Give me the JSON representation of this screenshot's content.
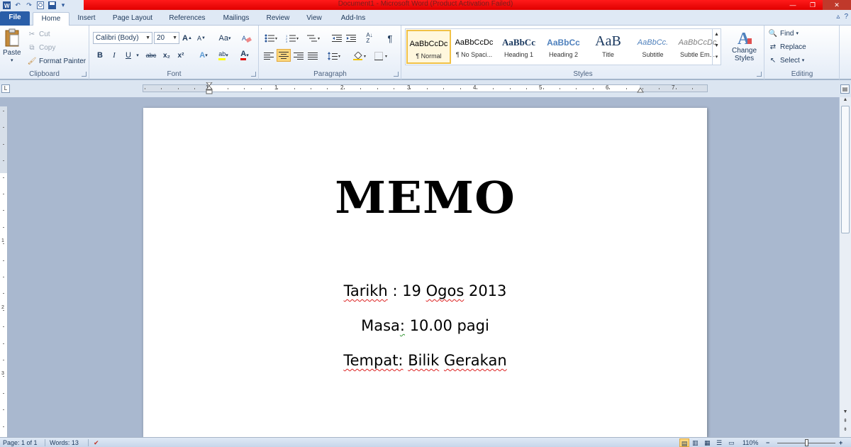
{
  "window": {
    "title": "Document1  -  Microsoft Word (Product Activation Failed)"
  },
  "qat": {
    "icons": [
      "word-logo-icon",
      "undo-icon",
      "redo-icon",
      "print-preview-icon",
      "save-icon",
      "customize-icon"
    ]
  },
  "tabs": {
    "file": "File",
    "home": "Home",
    "insert": "Insert",
    "page_layout": "Page Layout",
    "references": "References",
    "mailings": "Mailings",
    "review": "Review",
    "view": "View",
    "addins": "Add-Ins"
  },
  "clipboard": {
    "paste": "Paste",
    "cut": "Cut",
    "copy": "Copy",
    "format_painter": "Format Painter",
    "label": "Clipboard"
  },
  "font": {
    "family": "Calibri (Body)",
    "size": "20",
    "grow": "A",
    "shrink": "A",
    "change_case": "Aa",
    "bold": "B",
    "italic": "I",
    "underline": "U",
    "strike": "abc",
    "subscript": "x₂",
    "superscript": "x²",
    "label": "Font"
  },
  "paragraph": {
    "label": "Paragraph",
    "pilcrow": "¶"
  },
  "styles": {
    "label": "Styles",
    "items": [
      {
        "preview": "AaBbCcDc",
        "name": "¶ Normal"
      },
      {
        "preview": "AaBbCcDc",
        "name": "¶ No Spaci..."
      },
      {
        "preview": "AaBbCc",
        "name": "Heading 1"
      },
      {
        "preview": "AaBbCc",
        "name": "Heading 2"
      },
      {
        "preview": "AaB",
        "name": "Title"
      },
      {
        "preview": "AaBbCc.",
        "name": "Subtitle"
      },
      {
        "preview": "AaBbCcDc",
        "name": "Subtle Em..."
      }
    ],
    "change_styles_1": "Change",
    "change_styles_2": "Styles"
  },
  "editing": {
    "find": "Find",
    "replace": "Replace",
    "select": "Select",
    "label": "Editing"
  },
  "ruler": {
    "numbers": [
      "1",
      "1",
      "2",
      "3",
      "4",
      "5",
      "6",
      "7"
    ]
  },
  "document": {
    "title": "MEMO",
    "tarikh_label": "Tarikh",
    "tarikh_value": ": 19",
    "tarikh_month": "Ogos",
    "tarikh_year": "2013",
    "masa_label": "Masa",
    "masa_colon": ":",
    "masa_value": "10.00 pagi",
    "tempat_label": "Tempat:",
    "tempat_value1": "Bilik",
    "tempat_value2": "Gerakan"
  },
  "status": {
    "page": "Page: 1 of 1",
    "words": "Words: 13",
    "zoom": "110%",
    "minus": "−",
    "plus": "+"
  },
  "colors": {
    "title_bar": "#ff0000",
    "file_tab": "#2a5ea8",
    "selected_style": "#f0c146"
  }
}
